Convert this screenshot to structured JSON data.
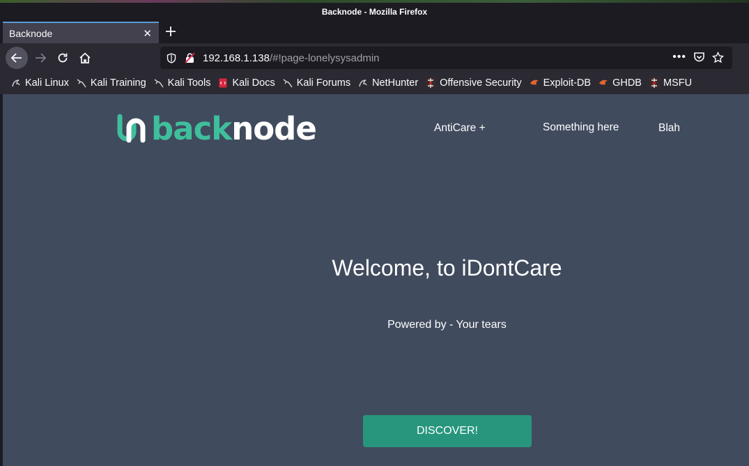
{
  "window": {
    "title": "Backnode - Mozilla Firefox"
  },
  "tabs": [
    {
      "label": "Backnode"
    }
  ],
  "urlbar": {
    "host": "192.168.1.138",
    "path": "/#!page-lonelysysadmin"
  },
  "bookmarks": [
    {
      "label": "Kali Linux",
      "icon": "kali-dragon-icon"
    },
    {
      "label": "Kali Training",
      "icon": "kali-dragon-icon"
    },
    {
      "label": "Kali Tools",
      "icon": "kali-dragon-icon"
    },
    {
      "label": "Kali Docs",
      "icon": "kali-docs-icon"
    },
    {
      "label": "Kali Forums",
      "icon": "kali-dragon-icon"
    },
    {
      "label": "NetHunter",
      "icon": "nethunter-icon"
    },
    {
      "label": "Offensive Security",
      "icon": "offsec-icon"
    },
    {
      "label": "Exploit-DB",
      "icon": "exploit-db-icon"
    },
    {
      "label": "GHDB",
      "icon": "ghdb-icon"
    },
    {
      "label": "MSFU",
      "icon": "offsec-icon"
    }
  ],
  "site": {
    "logo": {
      "part1": "back",
      "part2": "node"
    },
    "nav": [
      "AntiCare +",
      "Something here",
      "Blah"
    ],
    "headline": "Welcome, to iDontCare",
    "subline": "Powered by - Your tears",
    "cta": "DISCOVER!"
  },
  "colors": {
    "page_bg": "#414b5e",
    "accent_teal": "#3fbf9c",
    "button_bg": "#27967c",
    "browser_chrome": "#2b2a33"
  }
}
